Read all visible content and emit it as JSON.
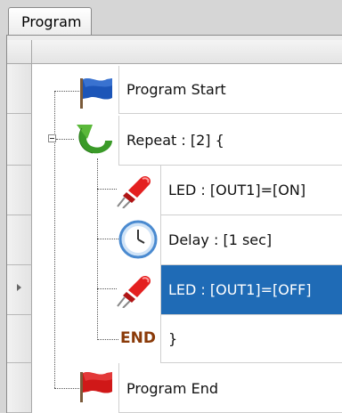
{
  "tab": {
    "label": "Program"
  },
  "rows": [
    {
      "label": "Program Start",
      "icon": "blue-flag-icon"
    },
    {
      "label": "Repeat : [2] {",
      "icon": "repeat-arrow-icon"
    },
    {
      "label": "LED : [OUT1]=[ON]",
      "icon": "red-led-icon"
    },
    {
      "label": "Delay : [1 sec]",
      "icon": "clock-icon"
    },
    {
      "label": "LED : [OUT1]=[OFF]",
      "icon": "red-led-icon",
      "selected": true
    },
    {
      "label": "}",
      "icon": "end-icon"
    },
    {
      "label": "Program End",
      "icon": "red-flag-icon"
    }
  ],
  "end_icon_text": "END",
  "colors": {
    "selection": "#1f6bb6",
    "end_text": "#8a3a08"
  }
}
